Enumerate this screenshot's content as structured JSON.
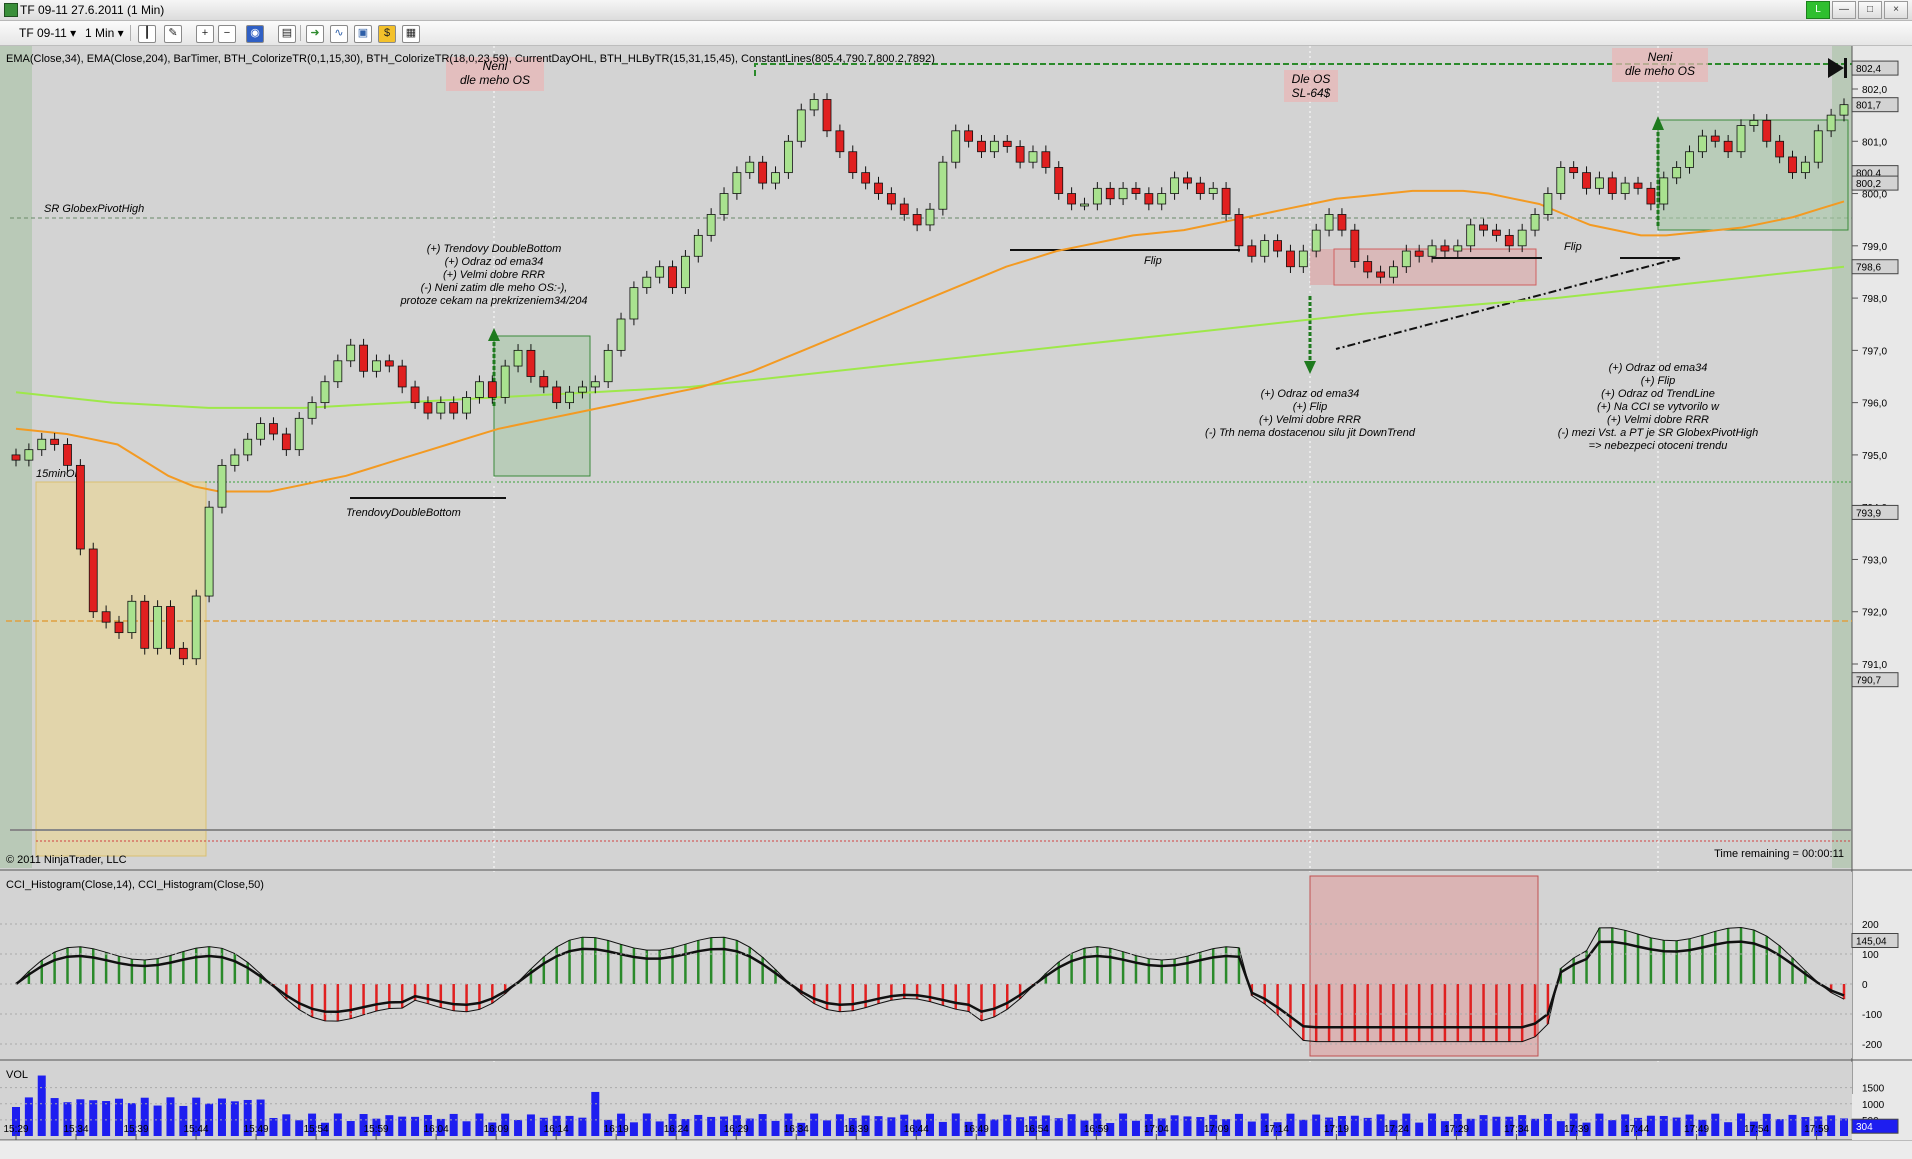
{
  "window": {
    "title": "TF 09-11  27.6.2011 (1 Min)",
    "min_label": "—",
    "max_label": "□",
    "close_label": "×",
    "extra_label": "L"
  },
  "toolbar": {
    "instrument": "TF 09-11",
    "interval": "1 Min"
  },
  "price_panel": {
    "indicators_label": "EMA(Close,34), EMA(Close,204), BarTimer, BTH_ColorizeTR(0,1,15,30), BTH_ColorizeTR(18,0,23,59), CurrentDayOHL, BTH_HLByTR(15,31,15,45), ConstantLines(805.4,790.7,800.2,7892)",
    "copyright": "© 2011 NinjaTrader, LLC",
    "time_remaining": "Time remaining = 00:00:11",
    "price_axis": [
      "802,0",
      "801,0",
      "800,0",
      "799,0",
      "798,0",
      "797,0",
      "796,0",
      "795,0",
      "794,0",
      "793,0",
      "792,0",
      "791,0"
    ],
    "price_markers": [
      {
        "text": "802,4",
        "color": "#d3d3d3"
      },
      {
        "text": "801,7",
        "color": "#d3d3d3"
      },
      {
        "text": "800,4",
        "color": "#d3d3d3"
      },
      {
        "text": "800,2",
        "color": "#d3d3d3"
      },
      {
        "text": "798,6",
        "color": "#d3d3d3"
      },
      {
        "text": "793,9",
        "color": "#d3d3d3"
      },
      {
        "text": "790,7",
        "color": "#d3d3d3"
      }
    ],
    "labels": {
      "sr_pivot": "SR GlobexPivotHigh",
      "or15": "15minOR",
      "double_bottom": "TrendovyDoubleBottom",
      "flip1": "Flip",
      "flip2": "Flip"
    },
    "annotations": {
      "neni1": [
        "Neni",
        "dle meho OS"
      ],
      "neni2": [
        "Neni",
        "dle meho OS"
      ],
      "dle_os": [
        "Dle OS",
        "SL-64$"
      ],
      "note1": [
        "(+) Trendovy DoubleBottom",
        "(+) Odraz od ema34",
        "(+) Velmi dobre RRR",
        "(-) Neni zatim dle meho OS:-),",
        "protoze cekam na prekrizeniem34/204"
      ],
      "note2": [
        "(+) Odraz od ema34",
        "(+) Flip",
        "(+) Velmi dobre RRR",
        "(-) Trh nema dostacenou silu jit DownTrend"
      ],
      "note3": [
        "(+) Odraz od ema34",
        "(+) Flip",
        "(+) Odraz od TrendLine",
        "(+) Na CCI se vytvorilo w",
        "(+) Velmi dobre RRR",
        "(-) mezi Vst. a PT je SR GlobexPivotHigh",
        "=> nebezpeci otoceni trendu"
      ]
    }
  },
  "cci_panel": {
    "label": "CCI_Histogram(Close,14), CCI_Histogram(Close,50)",
    "axis": [
      "200",
      "100",
      "0",
      "-100",
      "-200"
    ],
    "marker": "145,04"
  },
  "vol_panel": {
    "label": "VOL",
    "axis": [
      "1500",
      "1000",
      "500"
    ],
    "marker": "304"
  },
  "time_axis": [
    "15:29",
    "15:34",
    "15:39",
    "15:44",
    "15:49",
    "15:54",
    "15:59",
    "16:04",
    "16:09",
    "16:14",
    "16:19",
    "16:24",
    "16:29",
    "16:34",
    "16:39",
    "16:44",
    "16:49",
    "16:54",
    "16:59",
    "17:04",
    "17:09",
    "17:14",
    "17:19",
    "17:24",
    "17:29",
    "17:34",
    "17:39",
    "17:44",
    "17:49",
    "17:54",
    "17:59"
  ],
  "chart_data": {
    "type": "candlestick",
    "instrument": "TF 09-11",
    "interval": "1 Min",
    "bar_closes": [
      794.9,
      795.1,
      795.3,
      795.2,
      794.8,
      793.2,
      792.0,
      791.8,
      791.6,
      792.2,
      791.3,
      792.1,
      791.3,
      791.1,
      792.3,
      794.0,
      794.8,
      795.0,
      795.3,
      795.6,
      795.4,
      795.1,
      795.7,
      796.0,
      796.4,
      796.8,
      797.1,
      796.6,
      796.8,
      796.7,
      796.3,
      796.0,
      795.8,
      796.0,
      795.8,
      796.1,
      796.4,
      796.1,
      796.7,
      797.0,
      796.5,
      796.3,
      796.0,
      796.2,
      796.3,
      796.4,
      797.0,
      797.6,
      798.2,
      798.4,
      798.6,
      798.2,
      798.8,
      799.2,
      799.6,
      800.0,
      800.4,
      800.6,
      800.2,
      800.4,
      801.0,
      801.6,
      801.8,
      801.2,
      800.8,
      800.4,
      800.2,
      800.0,
      799.8,
      799.6,
      799.4,
      799.7,
      800.6,
      801.2,
      801.0,
      800.8,
      801.0,
      800.9,
      800.6,
      800.8,
      800.5,
      800.0,
      799.8,
      799.8,
      800.1,
      799.9,
      800.1,
      800.0,
      799.8,
      800.0,
      800.3,
      800.2,
      800.0,
      800.1,
      799.6,
      799.0,
      798.8,
      799.1,
      798.9,
      798.6,
      798.9,
      799.3,
      799.6,
      799.3,
      798.7,
      798.5,
      798.4,
      798.6,
      798.9,
      798.8,
      799.0,
      798.9,
      799.0,
      799.4,
      799.3,
      799.2,
      799.0,
      799.3,
      799.6,
      800.0,
      800.5,
      800.4,
      800.1,
      800.3,
      800.0,
      800.2,
      800.1,
      799.8,
      800.3,
      800.5,
      800.8,
      801.1,
      801.0,
      800.8,
      801.3,
      801.4,
      801.0,
      800.7,
      800.4,
      800.6,
      801.2,
      801.5,
      801.7
    ],
    "ema34": [
      795.5,
      795.45,
      795.4,
      795.3,
      795.2,
      794.9,
      794.6,
      794.4,
      794.3,
      794.3,
      794.3,
      794.4,
      794.5,
      794.6,
      794.75,
      794.9,
      795.05,
      795.2,
      795.35,
      795.5,
      795.6,
      795.7,
      795.8,
      795.9,
      796.0,
      796.1,
      796.2,
      796.3,
      796.45,
      796.6,
      796.8,
      797.0,
      797.2,
      797.4,
      797.6,
      797.8,
      798.0,
      798.2,
      798.4,
      798.6,
      798.75,
      798.9,
      799.0,
      799.1,
      799.2,
      799.25,
      799.3,
      799.4,
      799.5,
      799.6,
      799.7,
      799.8,
      799.9,
      799.95,
      800.0,
      800.05,
      800.05,
      800.05,
      800.0,
      799.9,
      799.8,
      799.6,
      799.4,
      799.3,
      799.2,
      799.2,
      799.25,
      799.3,
      799.35,
      799.45,
      799.55,
      799.7,
      799.85
    ],
    "ema204": [
      796.2,
      796.0,
      795.9,
      795.9,
      796.0,
      796.1,
      796.2,
      796.3,
      796.5,
      796.7,
      796.9,
      797.1,
      797.3,
      797.5,
      797.7,
      797.85,
      798.0,
      798.2,
      798.4,
      798.6
    ],
    "constant_lines": [
      805.4,
      790.7,
      800.2,
      7892
    ],
    "current_price": 801.7,
    "ylim": [
      790.5,
      802.6
    ],
    "cci_ylim": [
      -250,
      250
    ],
    "vol_ylim": [
      0,
      1800
    ]
  }
}
